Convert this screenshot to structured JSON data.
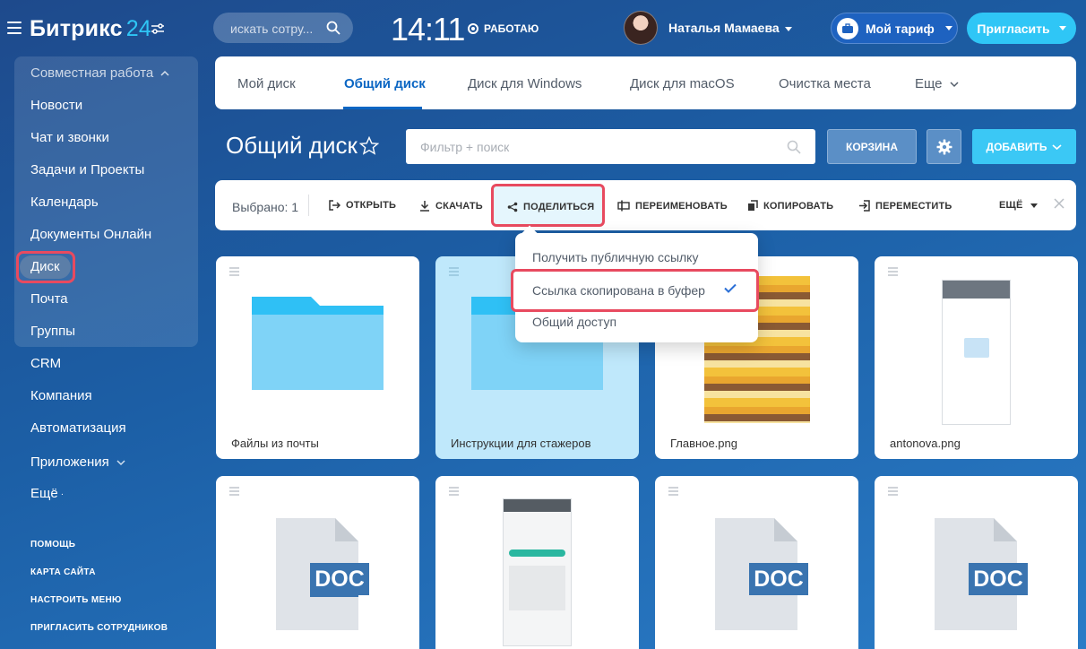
{
  "header": {
    "logo_main": "Битрикс",
    "logo_num": "24",
    "search_placeholder": "искать сотру...",
    "clock": "14:11",
    "work_status": "РАБОТАЮ",
    "user_name": "Наталья Мамаева",
    "tariff_label": "Мой тариф",
    "invite_label": "Пригласить"
  },
  "sidebar": {
    "group_title": "Совместная работа",
    "group_items": [
      "Новости",
      "Чат и звонки",
      "Задачи и Проекты",
      "Календарь",
      "Документы Онлайн",
      "Диск",
      "Почта",
      "Группы"
    ],
    "active_item": "Диск",
    "items": [
      "CRM",
      "Компания",
      "Автоматизация",
      "Приложения",
      "Ещё"
    ],
    "footer_links": [
      "ПОМОЩЬ",
      "КАРТА САЙТА",
      "НАСТРОИТЬ МЕНЮ",
      "ПРИГЛАСИТЬ СОТРУДНИКОВ"
    ]
  },
  "tabs": {
    "items": [
      "Мой диск",
      "Общий диск",
      "Диск для Windows",
      "Диск для macOS",
      "Очистка места",
      "Еще"
    ],
    "active": "Общий диск"
  },
  "title_row": {
    "title": "Общий диск",
    "filter_placeholder": "Фильтр + поиск",
    "trash_label": "КОРЗИНА",
    "add_label": "ДОБАВИТЬ"
  },
  "actionbar": {
    "selected": "Выбрано: 1",
    "open": "ОТКРЫТЬ",
    "download": "СКАЧАТЬ",
    "share": "ПОДЕЛИТЬСЯ",
    "rename": "ПЕРЕИМЕНОВАТЬ",
    "copy": "КОПИРОВАТЬ",
    "move": "ПЕРЕМЕСТИТЬ",
    "more": "ЕЩЁ"
  },
  "dropdown": {
    "items": [
      "Получить публичную ссылку",
      "Ссылка скопирована в буфер",
      "Общий доступ"
    ]
  },
  "files": [
    {
      "name": "Файлы из почты",
      "kind": "folder"
    },
    {
      "name": "Инструкции для стажеров",
      "kind": "folder",
      "selected": true
    },
    {
      "name": "Главное.png",
      "kind": "image"
    },
    {
      "name": "antonova.png",
      "kind": "image"
    },
    {
      "name": "",
      "kind": "doc"
    },
    {
      "name": "",
      "kind": "image"
    },
    {
      "name": "",
      "kind": "doc"
    },
    {
      "name": "",
      "kind": "doc"
    }
  ],
  "doc_badge": "DOC",
  "colors": {
    "accent": "#2fc6f6",
    "highlight": "#e84a5f",
    "tab_active": "#0b66c3",
    "folder": "#7fd3f7",
    "doc_badge": "#3a74b0"
  }
}
